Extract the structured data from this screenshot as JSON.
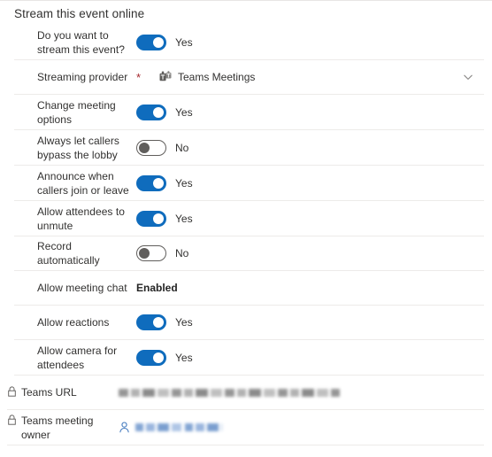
{
  "section": {
    "title": "Stream this event online"
  },
  "colors": {
    "toggle_on": "#0f6cbd",
    "toggle_off_border": "#605e5c",
    "required_asterisk": "#a4262c",
    "separator": "#edebe9",
    "text": "#323130",
    "link_blue": "#4a7fc1"
  },
  "rows": [
    {
      "label": "Do you want to stream this event?",
      "type": "toggle",
      "value": "Yes",
      "state": "on"
    },
    {
      "label": "Streaming provider",
      "type": "lookup",
      "required": true,
      "required_mark": "*",
      "value": "Teams Meetings",
      "icon": "teams-icon",
      "chevron": "chevron-down-icon"
    },
    {
      "label": "Change meeting options",
      "type": "toggle",
      "value": "Yes",
      "state": "on"
    },
    {
      "label": "Always let callers bypass the lobby",
      "type": "toggle",
      "value": "No",
      "state": "off"
    },
    {
      "label": "Announce when callers join or leave",
      "type": "toggle",
      "value": "Yes",
      "state": "on"
    },
    {
      "label": "Allow attendees to unmute",
      "type": "toggle",
      "value": "Yes",
      "state": "on"
    },
    {
      "label": "Record automatically",
      "type": "toggle",
      "value": "No",
      "state": "off"
    },
    {
      "label": "Allow meeting chat",
      "type": "text",
      "value": "Enabled"
    },
    {
      "label": "Allow reactions",
      "type": "toggle",
      "value": "Yes",
      "state": "on"
    },
    {
      "label": "Allow camera for attendees",
      "type": "toggle",
      "value": "Yes",
      "state": "on"
    },
    {
      "label": "Teams URL",
      "type": "locked-redacted",
      "lock_icon": "lock-icon",
      "value": ""
    },
    {
      "label": "Teams meeting owner",
      "type": "locked-person-redacted",
      "lock_icon": "lock-icon",
      "person_icon": "person-icon",
      "value": ""
    }
  ]
}
